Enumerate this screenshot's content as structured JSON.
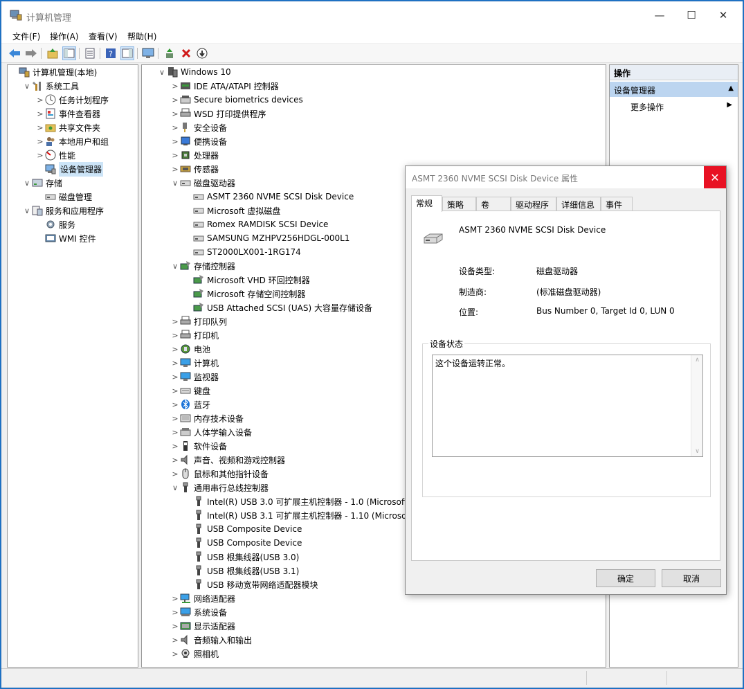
{
  "window": {
    "title": "计算机管理",
    "controls": {
      "minimize": "—",
      "maximize": "☐",
      "close": "✕"
    }
  },
  "menu": [
    "文件(F)",
    "操作(A)",
    "查看(V)",
    "帮助(H)"
  ],
  "left_tree": [
    {
      "label": "计算机管理(本地)",
      "expander": "",
      "icon": "computer-management-icon",
      "level": 0
    },
    {
      "label": "系统工具",
      "expander": "∨",
      "icon": "tools-icon",
      "level": 1
    },
    {
      "label": "任务计划程序",
      "expander": ">",
      "icon": "clock-icon",
      "level": 2
    },
    {
      "label": "事件查看器",
      "expander": ">",
      "icon": "event-viewer-icon",
      "level": 2
    },
    {
      "label": "共享文件夹",
      "expander": ">",
      "icon": "shared-folder-icon",
      "level": 2
    },
    {
      "label": "本地用户和组",
      "expander": ">",
      "icon": "users-icon",
      "level": 2
    },
    {
      "label": "性能",
      "expander": ">",
      "icon": "performance-icon",
      "level": 2
    },
    {
      "label": "设备管理器",
      "expander": "",
      "icon": "device-manager-icon",
      "level": 2,
      "selected": true
    },
    {
      "label": "存储",
      "expander": "∨",
      "icon": "storage-icon",
      "level": 1
    },
    {
      "label": "磁盘管理",
      "expander": "",
      "icon": "disk-management-icon",
      "level": 2
    },
    {
      "label": "服务和应用程序",
      "expander": "∨",
      "icon": "services-apps-icon",
      "level": 1
    },
    {
      "label": "服务",
      "expander": "",
      "icon": "services-icon",
      "level": 2
    },
    {
      "label": "WMI 控件",
      "expander": "",
      "icon": "wmi-icon",
      "level": 2
    }
  ],
  "device_tree": [
    {
      "label": "Windows 10",
      "expander": "∨",
      "icon": "computer-icon",
      "level": 0
    },
    {
      "label": "IDE ATA/ATAPI 控制器",
      "expander": ">",
      "icon": "ide-controller-icon",
      "level": 1
    },
    {
      "label": "Secure biometrics devices",
      "expander": ">",
      "icon": "biometrics-icon",
      "level": 1
    },
    {
      "label": "WSD 打印提供程序",
      "expander": ">",
      "icon": "printer-icon",
      "level": 1
    },
    {
      "label": "安全设备",
      "expander": ">",
      "icon": "security-device-icon",
      "level": 1
    },
    {
      "label": "便携设备",
      "expander": ">",
      "icon": "portable-device-icon",
      "level": 1
    },
    {
      "label": "处理器",
      "expander": ">",
      "icon": "processor-icon",
      "level": 1
    },
    {
      "label": "传感器",
      "expander": ">",
      "icon": "sensor-icon",
      "level": 1
    },
    {
      "label": "磁盘驱动器",
      "expander": "∨",
      "icon": "disk-drive-icon",
      "level": 1
    },
    {
      "label": "ASMT 2360 NVME SCSI Disk Device",
      "expander": "",
      "icon": "disk-drive-icon",
      "level": 2
    },
    {
      "label": "Microsoft 虚拟磁盘",
      "expander": "",
      "icon": "disk-drive-icon",
      "level": 2
    },
    {
      "label": "Romex RAMDISK SCSI Device",
      "expander": "",
      "icon": "disk-drive-icon",
      "level": 2
    },
    {
      "label": "SAMSUNG MZHPV256HDGL-000L1",
      "expander": "",
      "icon": "disk-drive-icon",
      "level": 2
    },
    {
      "label": "ST2000LX001-1RG174",
      "expander": "",
      "icon": "disk-drive-icon",
      "level": 2
    },
    {
      "label": "存储控制器",
      "expander": "∨",
      "icon": "storage-controller-icon",
      "level": 1
    },
    {
      "label": "Microsoft VHD 环回控制器",
      "expander": "",
      "icon": "storage-controller-icon",
      "level": 2
    },
    {
      "label": "Microsoft 存储空间控制器",
      "expander": "",
      "icon": "storage-controller-icon",
      "level": 2
    },
    {
      "label": "USB Attached SCSI (UAS) 大容量存储设备",
      "expander": "",
      "icon": "storage-controller-icon",
      "level": 2
    },
    {
      "label": "打印队列",
      "expander": ">",
      "icon": "printer-icon",
      "level": 1
    },
    {
      "label": "打印机",
      "expander": ">",
      "icon": "printer-icon",
      "level": 1
    },
    {
      "label": "电池",
      "expander": ">",
      "icon": "battery-icon",
      "level": 1
    },
    {
      "label": "计算机",
      "expander": ">",
      "icon": "monitor-icon",
      "level": 1
    },
    {
      "label": "监视器",
      "expander": ">",
      "icon": "monitor-icon",
      "level": 1
    },
    {
      "label": "键盘",
      "expander": ">",
      "icon": "keyboard-icon",
      "level": 1
    },
    {
      "label": "蓝牙",
      "expander": ">",
      "icon": "bluetooth-icon",
      "level": 1
    },
    {
      "label": "内存技术设备",
      "expander": ">",
      "icon": "memory-device-icon",
      "level": 1
    },
    {
      "label": "人体学输入设备",
      "expander": ">",
      "icon": "hid-icon",
      "level": 1
    },
    {
      "label": "软件设备",
      "expander": ">",
      "icon": "software-device-icon",
      "level": 1
    },
    {
      "label": "声音、视频和游戏控制器",
      "expander": ">",
      "icon": "speaker-icon",
      "level": 1
    },
    {
      "label": "鼠标和其他指针设备",
      "expander": ">",
      "icon": "mouse-icon",
      "level": 1
    },
    {
      "label": "通用串行总线控制器",
      "expander": "∨",
      "icon": "usb-icon",
      "level": 1
    },
    {
      "label": "Intel(R) USB 3.0 可扩展主机控制器 - 1.0 (Microsoft)",
      "expander": "",
      "icon": "usb-icon",
      "level": 2
    },
    {
      "label": "Intel(R) USB 3.1 可扩展主机控制器 - 1.10 (Microsoft)",
      "expander": "",
      "icon": "usb-icon",
      "level": 2
    },
    {
      "label": "USB Composite Device",
      "expander": "",
      "icon": "usb-icon",
      "level": 2
    },
    {
      "label": "USB Composite Device",
      "expander": "",
      "icon": "usb-icon",
      "level": 2
    },
    {
      "label": "USB 根集线器(USB 3.0)",
      "expander": "",
      "icon": "usb-icon",
      "level": 2
    },
    {
      "label": "USB 根集线器(USB 3.1)",
      "expander": "",
      "icon": "usb-icon",
      "level": 2
    },
    {
      "label": "USB 移动宽带网络适配器模块",
      "expander": "",
      "icon": "usb-icon",
      "level": 2
    },
    {
      "label": "网络适配器",
      "expander": ">",
      "icon": "network-adapter-icon",
      "level": 1
    },
    {
      "label": "系统设备",
      "expander": ">",
      "icon": "system-device-icon",
      "level": 1
    },
    {
      "label": "显示适配器",
      "expander": ">",
      "icon": "display-adapter-icon",
      "level": 1
    },
    {
      "label": "音频输入和输出",
      "expander": ">",
      "icon": "audio-icon",
      "level": 1
    },
    {
      "label": "照相机",
      "expander": ">",
      "icon": "camera-icon",
      "level": 1
    }
  ],
  "actions": {
    "header": "操作",
    "section": "设备管理器",
    "section_arrow": "▲",
    "more": "更多操作",
    "more_arrow": "▶"
  },
  "dialog": {
    "title": "ASMT 2360 NVME SCSI Disk Device 属性",
    "close": "✕",
    "tabs": [
      "常规",
      "策略",
      "卷",
      "驱动程序",
      "详细信息",
      "事件"
    ],
    "device_name": "ASMT 2360 NVME SCSI Disk Device",
    "props": [
      {
        "label": "设备类型:",
        "value": "磁盘驱动器"
      },
      {
        "label": "制造商:",
        "value": "(标准磁盘驱动器)"
      },
      {
        "label": "位置:",
        "value": "Bus Number 0, Target Id 0, LUN 0"
      }
    ],
    "status_group": "设备状态",
    "status_text": "这个设备运转正常。",
    "ok": "确定",
    "cancel": "取消"
  }
}
